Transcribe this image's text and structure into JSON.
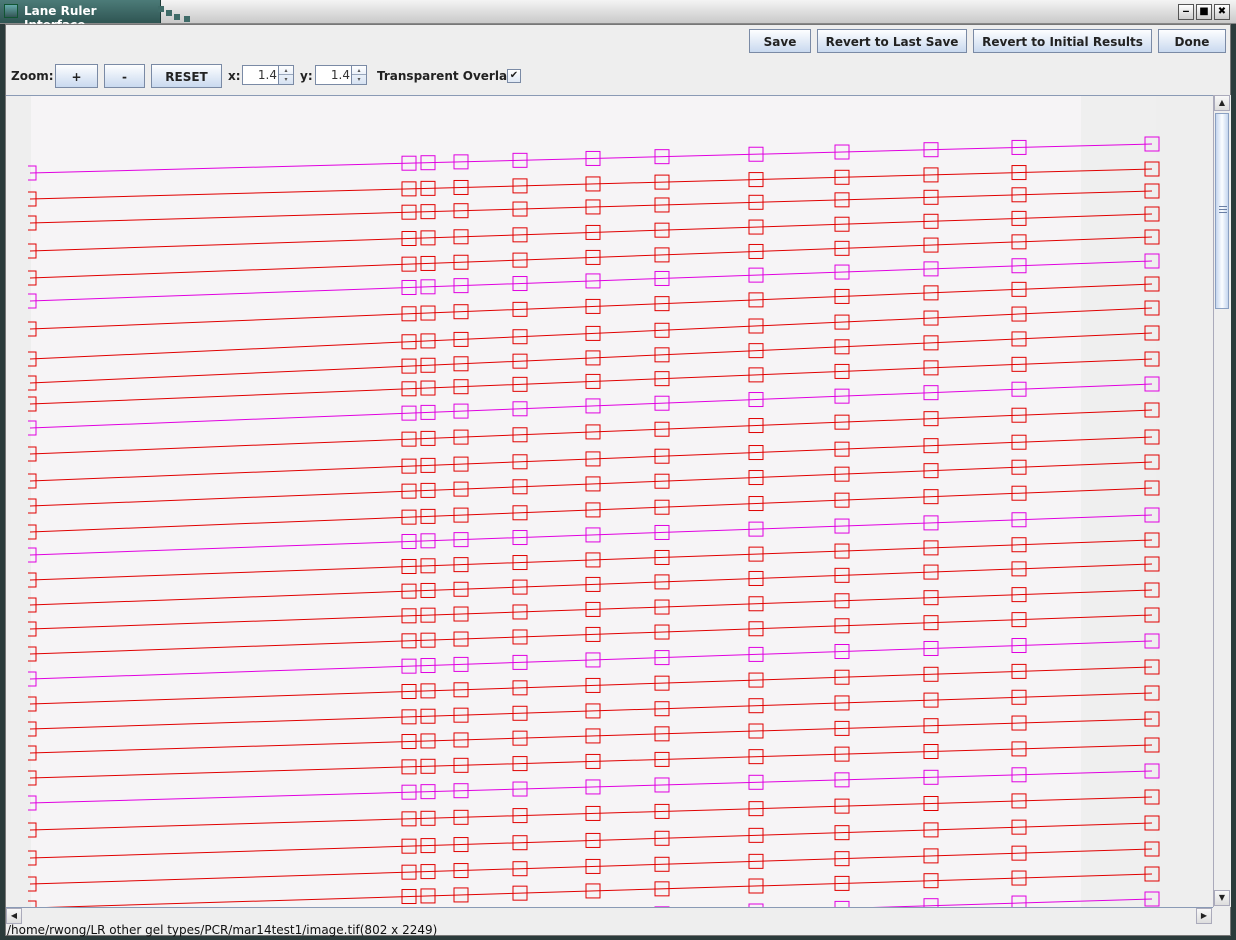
{
  "window": {
    "title": "Lane Ruler Interface",
    "controls": {
      "minimize": "‒",
      "maximize": "■",
      "close": "✖"
    }
  },
  "toolbar": {
    "save_label": "Save",
    "revert_last_label": "Revert to Last Save",
    "revert_initial_label": "Revert to Initial Results",
    "done_label": "Done"
  },
  "zoom": {
    "label": "Zoom:",
    "plus_label": "+",
    "minus_label": "-",
    "reset_label": "RESET",
    "x_label": "x:",
    "x_value": "1.4",
    "y_label": "y:",
    "y_value": "1.4",
    "spin_up": "▴",
    "spin_down": "▾"
  },
  "overlay": {
    "transparent_label": "Transparent Overlay",
    "transparent_checked": true,
    "check_glyph": "✔",
    "lane_count": 31,
    "marker_lanes": [
      0,
      5,
      10,
      15,
      20,
      25,
      30
    ],
    "colors": {
      "lane": "#e00000",
      "marker_lane": "#e000e0"
    }
  },
  "scroll": {
    "up": "▲",
    "down": "▼",
    "left": "◀",
    "right": "▶"
  },
  "status": {
    "path": "/home/rwong/LR other gel types/PCR/mar14test1/image.tif(802 x 2249)"
  }
}
